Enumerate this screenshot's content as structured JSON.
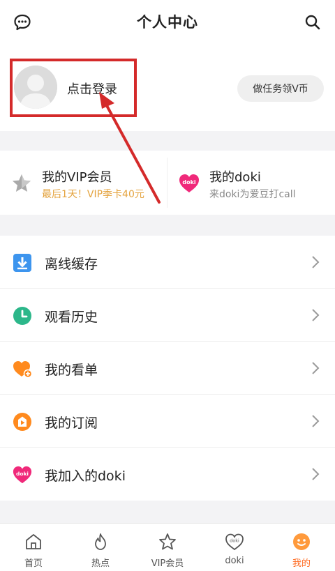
{
  "header": {
    "title": "个人中心",
    "left_icon": "message-icon",
    "right_icon": "search-icon"
  },
  "profile": {
    "login_label": "点击登录",
    "task_button_label": "做任务领V币"
  },
  "cards": {
    "vip": {
      "title": "我的VIP会员",
      "subtitle": "最后1天！VIP季卡40元",
      "icon": "star-icon"
    },
    "doki": {
      "title": "我的doki",
      "subtitle": "来doki为爱豆打call",
      "icon": "doki-icon",
      "icon_text": "doki"
    }
  },
  "menu": {
    "items": [
      {
        "label": "离线缓存",
        "icon": "download-icon"
      },
      {
        "label": "观看历史",
        "icon": "clock-icon"
      },
      {
        "label": "我的看单",
        "icon": "heart-add-icon"
      },
      {
        "label": "我的订阅",
        "icon": "subscribe-icon"
      },
      {
        "label": "我加入的doki",
        "icon": "doki-icon",
        "icon_text": "doki"
      }
    ]
  },
  "bottom_nav": {
    "items": [
      {
        "label": "首页",
        "icon": "home-icon"
      },
      {
        "label": "热点",
        "icon": "flame-icon"
      },
      {
        "label": "VIP会员",
        "icon": "vip-star-icon"
      },
      {
        "label": "doki",
        "icon": "doki-heart-icon",
        "icon_text": "doki"
      },
      {
        "label": "我的",
        "icon": "smile-icon"
      }
    ],
    "active_index": 4
  },
  "colors": {
    "accent": "#ff6b22",
    "vip_gold": "#e4a33e",
    "highlight_red": "#d42a2a",
    "doki_pink": "#f0297a"
  }
}
